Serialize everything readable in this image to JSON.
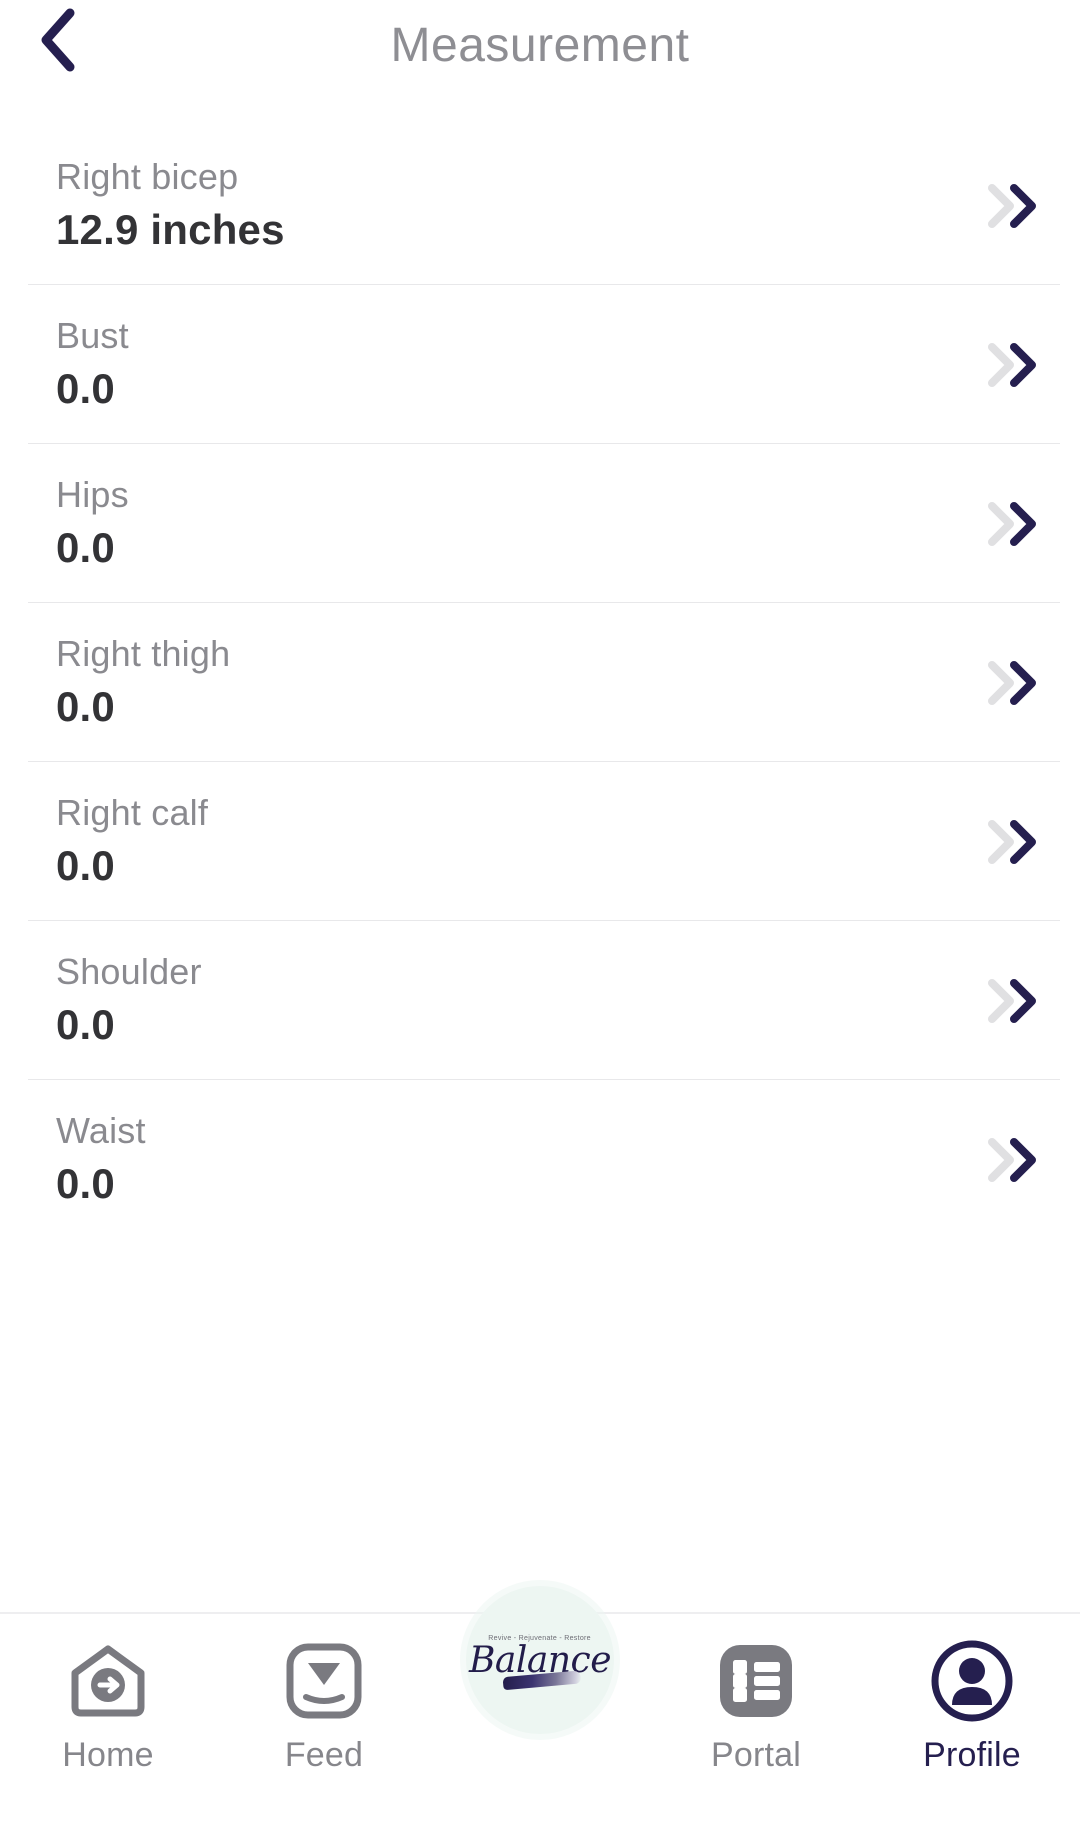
{
  "header": {
    "title": "Measurement",
    "back_icon": "chevron-left-icon"
  },
  "colors": {
    "accent_navy": "#251f4f",
    "label_gray": "#8a8a8f",
    "value_dark": "#333336",
    "divider": "#e8e8ea",
    "chevron_light": "#e0e0e2",
    "badge_mint": "#edf6f2"
  },
  "measurements": [
    {
      "label": "Right bicep",
      "value": "12.9 inches",
      "chevron_icon": "double-chevron-right-icon"
    },
    {
      "label": "Bust",
      "value": "0.0",
      "chevron_icon": "double-chevron-right-icon"
    },
    {
      "label": "Hips",
      "value": "0.0",
      "chevron_icon": "double-chevron-right-icon"
    },
    {
      "label": "Right thigh",
      "value": "0.0",
      "chevron_icon": "double-chevron-right-icon"
    },
    {
      "label": "Right calf",
      "value": "0.0",
      "chevron_icon": "double-chevron-right-icon"
    },
    {
      "label": "Shoulder",
      "value": "0.0",
      "chevron_icon": "double-chevron-right-icon"
    },
    {
      "label": "Waist",
      "value": "0.0",
      "chevron_icon": "double-chevron-right-icon"
    }
  ],
  "logo": {
    "tagline": "Revive - Rejuvenate - Restore",
    "word": "Balance"
  },
  "bottom_nav": {
    "items": [
      {
        "label": "Home",
        "icon": "home-arrow-icon",
        "active": false
      },
      {
        "label": "Feed",
        "icon": "inbox-download-icon",
        "active": false
      },
      {
        "label": "Portal",
        "icon": "list-grid-icon",
        "active": false
      },
      {
        "label": "Profile",
        "icon": "person-circle-icon",
        "active": true
      }
    ]
  }
}
